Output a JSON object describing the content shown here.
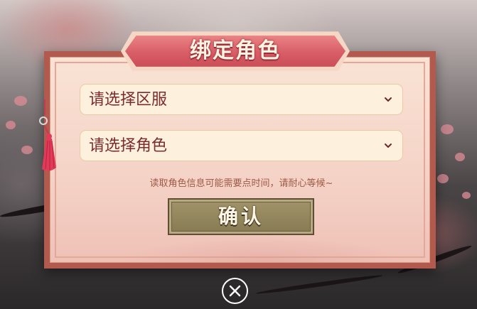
{
  "dialog": {
    "title": "绑定角色",
    "server_select": {
      "placeholder": "请选择区服",
      "icon": "chevron-down-icon"
    },
    "role_select": {
      "placeholder": "请选择角色",
      "icon": "chevron-down-icon"
    },
    "hint": "读取角色信息可能需要点时间，请耐心等候~",
    "confirm_label": "确认"
  },
  "close": {
    "icon": "close-icon"
  },
  "colors": {
    "title_banner": "#d85d66",
    "dialog_frame": "#b25a4e",
    "select_bg": "#fdf0dc",
    "select_text": "#7b2c2c",
    "hint_text": "#9e5a46",
    "button_bg": "#867a52",
    "tassel": "#e23a59"
  }
}
